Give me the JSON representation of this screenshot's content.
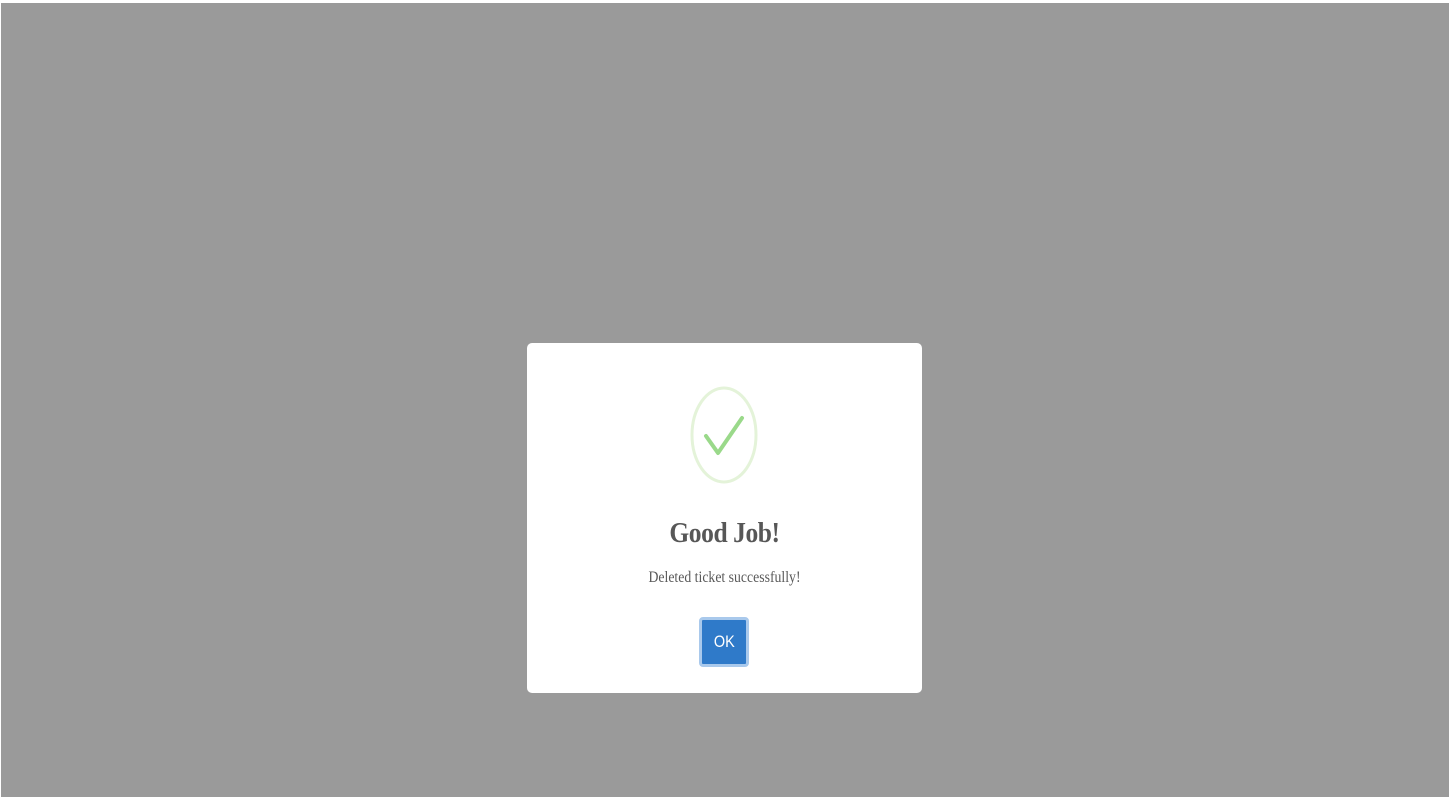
{
  "dialog": {
    "icon": "success-check-icon",
    "title": "Good Job!",
    "message": "Deleted ticket successfully!",
    "confirm_label": "OK"
  },
  "colors": {
    "overlay": "#9a9a9a",
    "dialog_background": "#ffffff",
    "success_ring": "#e4f3d9",
    "success_check": "#9ad98a",
    "title_text": "#575757",
    "message_text": "#595959",
    "button_background": "#2f7ac9",
    "button_focus_ring": "#a9c9ec",
    "button_text": "#ffffff"
  }
}
